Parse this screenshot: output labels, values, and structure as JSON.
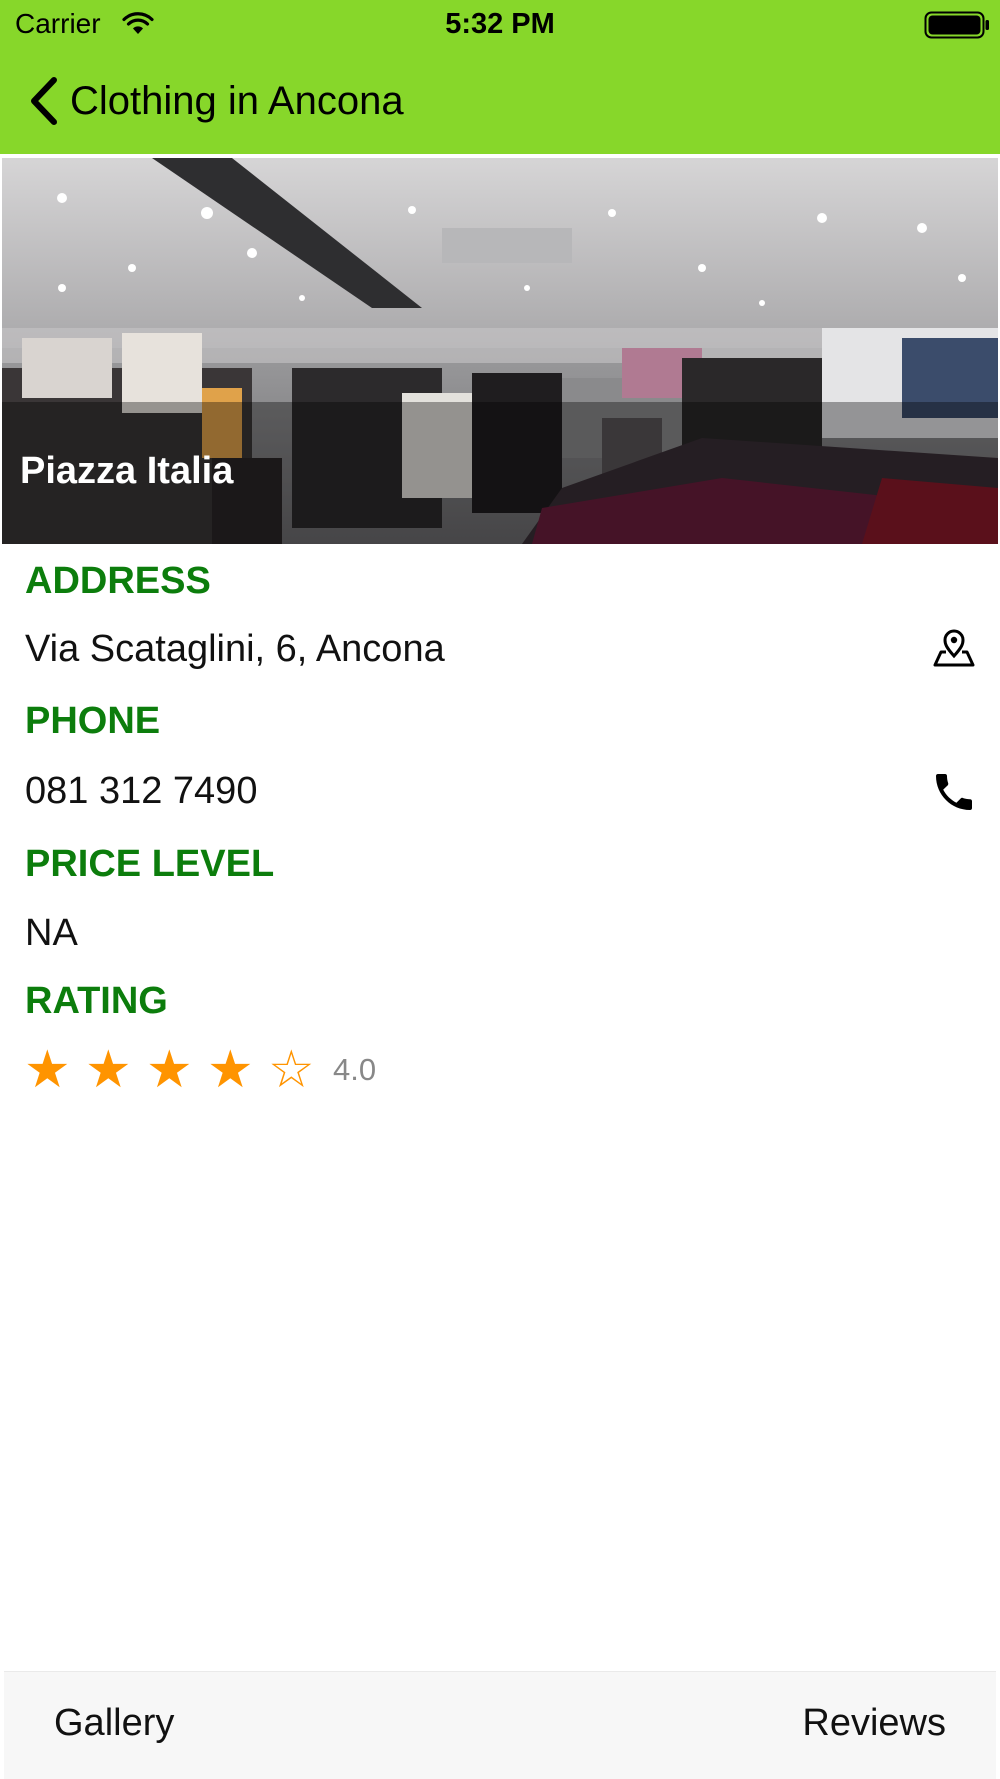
{
  "status_bar": {
    "carrier": "Carrier",
    "time": "5:32 PM"
  },
  "nav": {
    "title": "Clothing in Ancona"
  },
  "hero": {
    "place_name": "Piazza Italia"
  },
  "details": {
    "address_label": "ADDRESS",
    "address_value": "Via Scataglini, 6, Ancona",
    "phone_label": "PHONE",
    "phone_value": "081 312 7490",
    "price_label": "PRICE LEVEL",
    "price_value": "NA",
    "rating_label": "RATING",
    "rating_value": "4.0",
    "rating_stars": 4,
    "rating_max": 5
  },
  "bottom_bar": {
    "gallery_label": "Gallery",
    "reviews_label": "Reviews"
  },
  "colors": {
    "header_bg": "#87d72a",
    "section_label": "#0c7d0c",
    "star": "#ff9400"
  },
  "icons": {
    "back": "chevron-left-icon",
    "address": "map-pin-icon",
    "phone": "phone-icon"
  }
}
